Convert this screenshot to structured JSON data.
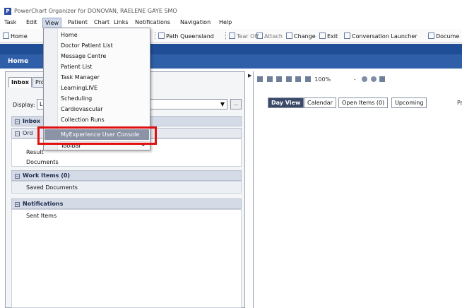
{
  "window": {
    "app_icon": "P",
    "title": "PowerChart Organizer for DONOVAN, RAELENE GAYE SMO"
  },
  "menubar": {
    "items": [
      "Task",
      "Edit",
      "View",
      "Patient",
      "Chart",
      "Links",
      "Notifications",
      "Navigation",
      "Help"
    ]
  },
  "toolbar": {
    "home": "Home",
    "path_queensland": "Path Queensland",
    "tear_off": "Tear Off",
    "attach": "Attach",
    "change": "Change",
    "exit": "Exit",
    "conversation_launcher": "Conversation Launcher",
    "documents": "Docume"
  },
  "page": {
    "title": "Home"
  },
  "left_pane": {
    "tabs": [
      "Inbox",
      "Pro"
    ],
    "display_label": "Display:",
    "display_value": "L",
    "display_button": "...",
    "sections": {
      "inbox": {
        "label": "Inbox"
      },
      "orders": {
        "label": "Ord"
      },
      "results": "Result",
      "documents": "Documents",
      "work_items": {
        "label": "Work Items (0)",
        "rows": [
          "Saved Documents"
        ]
      },
      "notifications": {
        "label": "Notifications",
        "rows": [
          "Sent Items"
        ]
      }
    }
  },
  "right_pane": {
    "zoom": "100%",
    "view_tabs": [
      "Day View",
      "Calendar",
      "Open Items (0)",
      "Upcoming"
    ],
    "partial_text": "Pa"
  },
  "view_menu": {
    "items": [
      "Home",
      "Doctor Patient List",
      "Message Centre",
      "Patient List",
      "Task Manager",
      "LearningLIVE",
      "Scheduling",
      "Cardiovascular",
      "Collection Runs",
      "MyExperience User Console",
      "Toolbar"
    ],
    "highlighted": "MyExperience User Console",
    "submenu_arrow": "▸"
  },
  "colors": {
    "band_dark": "#1f4d96",
    "band": "#2e5fa8",
    "highlight": "#8a94a6",
    "annotation_red": "#e01010"
  }
}
